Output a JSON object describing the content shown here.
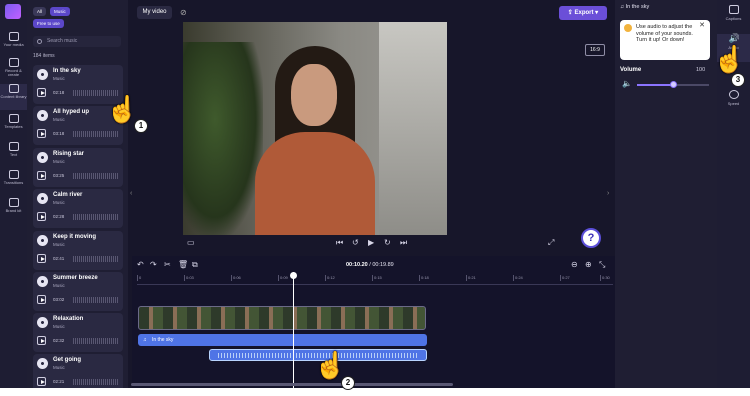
{
  "left_rail": {
    "items": [
      {
        "label": "Your media"
      },
      {
        "label": "Record & create"
      },
      {
        "label": "Content library"
      },
      {
        "label": "Templates"
      },
      {
        "label": "Text"
      },
      {
        "label": "Transitions"
      },
      {
        "label": "Brand kit"
      }
    ]
  },
  "filters": {
    "all": "All",
    "music": "Music",
    "free": "Free to use"
  },
  "search": {
    "placeholder": "Search music"
  },
  "items_count": "184 items",
  "tracks": [
    {
      "title": "In the sky",
      "type": "Music",
      "duration": "02:18"
    },
    {
      "title": "All hyped up",
      "type": "Music",
      "duration": "03:18"
    },
    {
      "title": "Rising star",
      "type": "Music",
      "duration": "03:25"
    },
    {
      "title": "Calm river",
      "type": "Music",
      "duration": "02:28"
    },
    {
      "title": "Keep it moving",
      "type": "Music",
      "duration": "02:41"
    },
    {
      "title": "Summer breeze",
      "type": "Music",
      "duration": "03:02"
    },
    {
      "title": "Relaxation",
      "type": "Music",
      "duration": "02:32"
    },
    {
      "title": "Get going",
      "type": "Music",
      "duration": "02:21"
    }
  ],
  "topbar": {
    "video_tab": "My video",
    "export": "Export",
    "ratio": "16:9"
  },
  "properties": {
    "title": "In the sky",
    "tip": "Use audio to adjust the volume of your sounds. Turn it up! Or down!",
    "volume_label": "Volume",
    "volume_value": "100",
    "volume_level": 0.5
  },
  "right_rail": {
    "items": [
      {
        "label": "Captions"
      },
      {
        "label": "Audio"
      },
      {
        "label": "Speed"
      }
    ]
  },
  "timeline": {
    "current": "00:10.20",
    "separator": " / ",
    "total": "00:19.89",
    "ticks": [
      "0",
      "0:03",
      "0:06",
      "0:09",
      "0:12",
      "0:15",
      "0:18",
      "0:21",
      "0:24",
      "0:27",
      "0:30"
    ],
    "audio_clip_label": "In the sky"
  },
  "steps": [
    "1",
    "2",
    "3"
  ],
  "help": "?"
}
